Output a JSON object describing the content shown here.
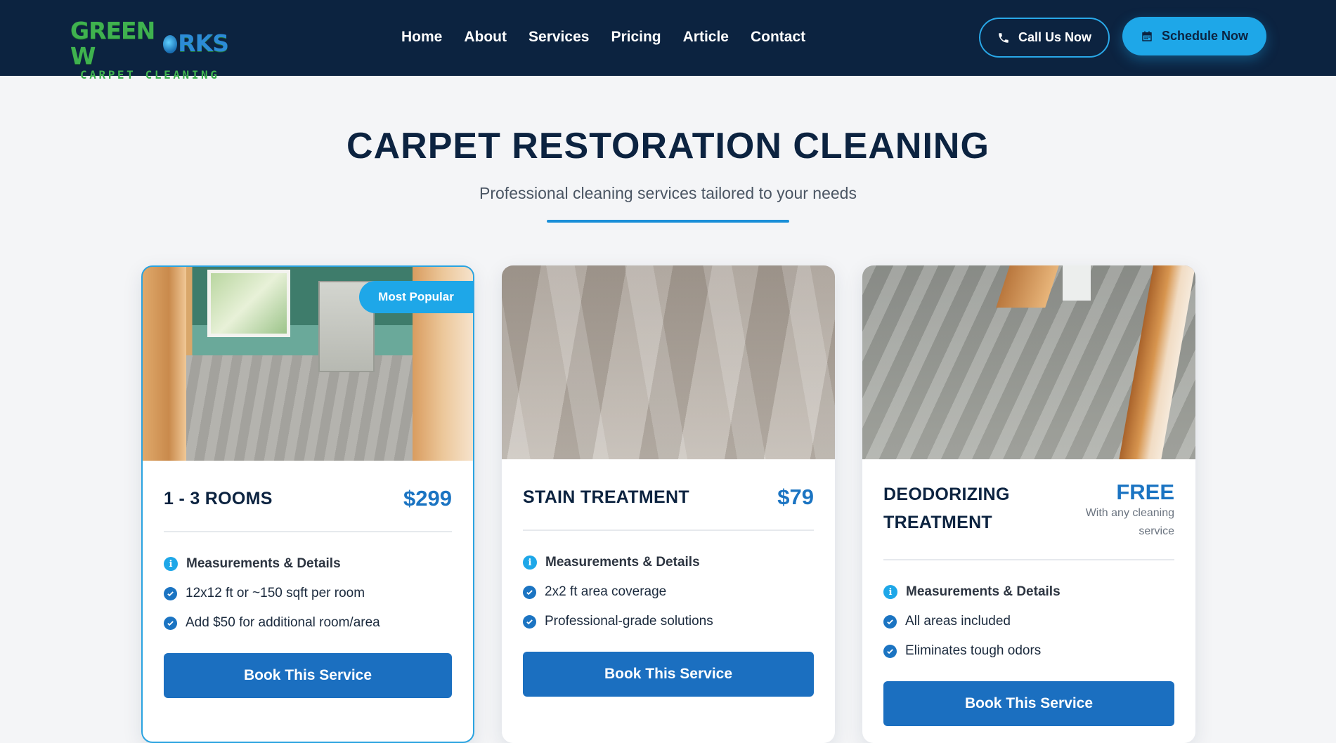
{
  "header": {
    "logo": {
      "line1_a": "GREEN W",
      "line1_b": "RKS",
      "line2": "CARPET CLEANING"
    },
    "nav": [
      "Home",
      "About",
      "Services",
      "Pricing",
      "Article",
      "Contact"
    ],
    "call_label": "Call Us Now",
    "schedule_label": "Schedule Now"
  },
  "main": {
    "title": "CARPET RESTORATION CLEANING",
    "subtitle": "Professional cleaning services tailored to your needs",
    "cards": [
      {
        "name": "1 - 3 ROOMS",
        "price": "$299",
        "price_note": "",
        "badge": "Most Popular",
        "section_label": "Measurements & Details",
        "features": [
          "12x12 ft or ~150 sqft per room",
          "Add $50 for additional room/area"
        ],
        "button": "Book This Service"
      },
      {
        "name": "STAIN TREATMENT",
        "price": "$79",
        "price_note": "",
        "section_label": "Measurements & Details",
        "features": [
          "2x2 ft area coverage",
          "Professional-grade solutions"
        ],
        "button": "Book This Service"
      },
      {
        "name_line1": "DEODORIZING",
        "name_line2": "TREATMENT",
        "price": "FREE",
        "price_note": "With any cleaning service",
        "section_label": "Measurements & Details",
        "features": [
          "All areas included",
          "Eliminates tough odors"
        ],
        "button": "Book This Service"
      }
    ]
  },
  "colors": {
    "header_bg": "#0c2340",
    "accent": "#1ea7e8",
    "button_blue": "#1b6fc0",
    "price_blue": "#1b74c2",
    "logo_green": "#3fb24f"
  },
  "icons": [
    "phone-icon",
    "calendar-icon",
    "info-icon",
    "check-circle-icon"
  ]
}
